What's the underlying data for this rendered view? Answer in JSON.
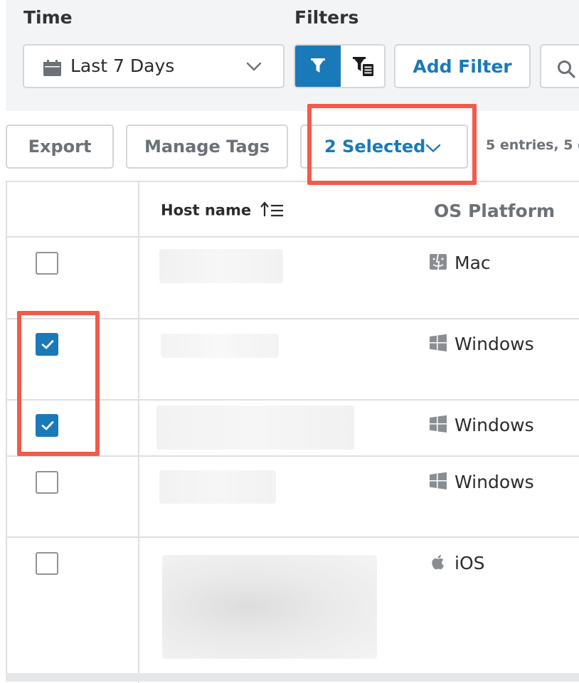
{
  "filters_bar": {
    "time_label": "Time",
    "filters_label": "Filters",
    "time_value": "Last 7 Days",
    "add_filter_label": "Add Filter"
  },
  "toolbar": {
    "export_label": "Export",
    "manage_tags_label": "Manage Tags",
    "selected_label": "2 Selected",
    "entries_text": "5 entries, 5 d"
  },
  "table": {
    "columns": [
      "Host name",
      "OS Platform"
    ],
    "rows": [
      {
        "checked": false,
        "os": "Mac"
      },
      {
        "checked": true,
        "os": "Windows"
      },
      {
        "checked": true,
        "os": "Windows"
      },
      {
        "checked": false,
        "os": "Windows"
      },
      {
        "checked": false,
        "os": "iOS"
      }
    ]
  },
  "colors": {
    "accent": "#1a79b8",
    "highlight": "#f25a4b",
    "border": "#d3d6da",
    "panel_bg": "#f3f4f6"
  },
  "icons": [
    "calendar-icon",
    "chevron-down-icon",
    "filter-icon",
    "filter-list-icon",
    "search-icon",
    "sort-ascending-icon",
    "checkmark-icon",
    "mac-finder-icon",
    "windows-icon",
    "apple-icon"
  ]
}
